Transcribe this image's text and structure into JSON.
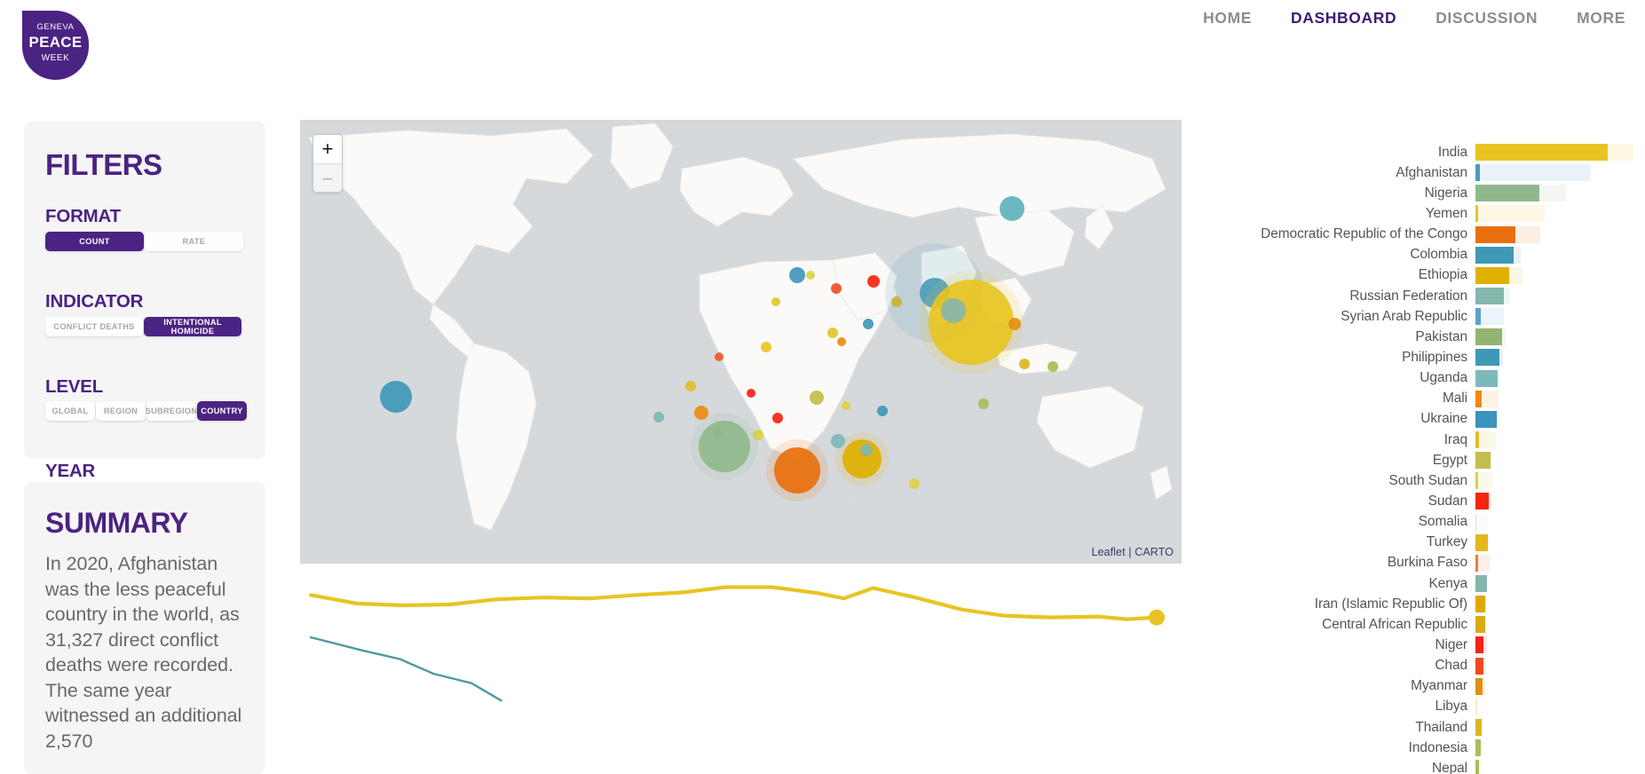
{
  "header": {
    "logo": {
      "line1": "GENEVA",
      "line2": "PEACE",
      "line3": "WEEK",
      "color": "#4b2382"
    },
    "nav": [
      {
        "label": "HOME",
        "active": false
      },
      {
        "label": "DASHBOARD",
        "active": true
      },
      {
        "label": "DISCUSSION",
        "active": false
      },
      {
        "label": "MORE",
        "active": false
      }
    ]
  },
  "filters": {
    "title": "FILTERS",
    "groups": [
      {
        "label": "FORMAT",
        "options": [
          {
            "label": "COUNT",
            "selected": true
          },
          {
            "label": "RATE",
            "selected": false
          }
        ]
      },
      {
        "label": "INDICATOR",
        "options": [
          {
            "label": "CONFLICT DEATHS",
            "selected": false
          },
          {
            "label": "INTENTIONAL HOMICIDE",
            "selected": true
          }
        ]
      },
      {
        "label": "LEVEL",
        "options": [
          {
            "label": "GLOBAL",
            "selected": false
          },
          {
            "label": "REGION",
            "selected": false
          },
          {
            "label": "SUBREGION",
            "selected": false
          },
          {
            "label": "COUNTRY",
            "selected": true
          }
        ]
      }
    ],
    "year": {
      "label": "YEAR",
      "value": "2020",
      "min": 1990,
      "max": 2020,
      "position_pct": 100
    }
  },
  "summary": {
    "title": "SUMMARY",
    "text": "In 2020, Afghanistan was the less peaceful country in the world, as 31,327 direct conflict deaths were recorded. The same year witnessed an additional 2,570"
  },
  "map": {
    "zoom_in_label": "+",
    "zoom_out_label": "−",
    "attribution_leaflet": "Leaflet",
    "attribution_sep": " | ",
    "attribution_carto": "CARTO",
    "ocean_color": "#d5d9db",
    "land_color": "#fbfaf8"
  },
  "chart_data": [
    {
      "type": "bar",
      "title": "",
      "orientation": "horizontal",
      "xlabel": "",
      "ylabel": "",
      "note": "Two stacked measures per country: foreground = intentional homicide count, background (lighter tint) = total. Values are pixel-proportional estimates of bar length (0-1 of chart width).",
      "categories": [
        "India",
        "Afghanistan",
        "Nigeria",
        "Yemen",
        "Democratic Republic of the Congo",
        "Colombia",
        "Ethiopia",
        "Russian Federation",
        "Syrian Arab Republic",
        "Pakistan",
        "Philippines",
        "Uganda",
        "Mali",
        "Ukraine",
        "Iraq",
        "Egypt",
        "South Sudan",
        "Sudan",
        "Somalia",
        "Turkey",
        "Burkina Faso",
        "Kenya",
        "Iran (Islamic Republic Of)",
        "Central African Republic",
        "Niger",
        "Chad",
        "Myanmar",
        "Libya",
        "Thailand",
        "Indonesia",
        "Nepal"
      ],
      "series": [
        {
          "name": "foreground",
          "values": [
            0.805,
            0.029,
            0.39,
            0.014,
            0.245,
            0.235,
            0.205,
            0.175,
            0.032,
            0.16,
            0.145,
            0.135,
            0.04,
            0.13,
            0.022,
            0.09,
            0.018,
            0.08,
            0.006,
            0.075,
            0.017,
            0.07,
            0.062,
            0.06,
            0.05,
            0.046,
            0.044,
            0.01,
            0.038,
            0.03,
            0.024
          ]
        },
        {
          "name": "background",
          "values": [
            0.96,
            0.7,
            0.55,
            0.42,
            0.395,
            0.275,
            0.285,
            0.205,
            0.175,
            0.185,
            0.165,
            0.145,
            0.14,
            0.135,
            0.125,
            0.1,
            0.105,
            0.09,
            0.08,
            0.078,
            0.085,
            0.072,
            0.064,
            0.062,
            0.07,
            0.065,
            0.058,
            0.05,
            0.04,
            0.032,
            0.026
          ]
        }
      ],
      "colors": [
        "#e8c422",
        "#4a9cba",
        "#8fb98c",
        "#e2c72a",
        "#e96f0d",
        "#3f98b8",
        "#e0b000",
        "#86b6ad",
        "#5aa4c1",
        "#93b572",
        "#3f98b8",
        "#7cb9bb",
        "#ee8a12",
        "#3a94bd",
        "#ddbf2d",
        "#c3bd4a",
        "#ded04a",
        "#f4260f",
        "#cfe0e4",
        "#e2b81a",
        "#ef7a43",
        "#86b6ad",
        "#e0a800",
        "#d9ab12",
        "#f42314",
        "#ed4b1a",
        "#e08f13",
        "#f2efcf",
        "#dcb620",
        "#a9bd5e",
        "#a5be52"
      ]
    },
    {
      "type": "line",
      "title": "",
      "xlabel": "",
      "ylabel": "",
      "note": "Time series trend lines under the map; gold line carries an end-point marker.",
      "series": [
        {
          "name": "line-gold",
          "color": "#e8c422",
          "marker_end": true,
          "points_pct": [
            [
              0.0,
              0.28
            ],
            [
              0.055,
              0.38
            ],
            [
              0.11,
              0.4
            ],
            [
              0.165,
              0.39
            ],
            [
              0.22,
              0.33
            ],
            [
              0.275,
              0.31
            ],
            [
              0.33,
              0.32
            ],
            [
              0.385,
              0.28
            ],
            [
              0.44,
              0.25
            ],
            [
              0.49,
              0.19
            ],
            [
              0.545,
              0.19
            ],
            [
              0.6,
              0.26
            ],
            [
              0.63,
              0.32
            ],
            [
              0.665,
              0.2
            ],
            [
              0.715,
              0.31
            ],
            [
              0.77,
              0.45
            ],
            [
              0.82,
              0.52
            ],
            [
              0.875,
              0.54
            ],
            [
              0.93,
              0.53
            ],
            [
              0.965,
              0.56
            ],
            [
              1.0,
              0.54
            ]
          ]
        },
        {
          "name": "line-teal",
          "color": "#4e9a9c",
          "marker_end": false,
          "points_pct": [
            [
              0.0,
              0.77
            ],
            [
              0.06,
              0.92
            ],
            [
              0.105,
              1.02
            ],
            [
              0.145,
              1.19
            ],
            [
              0.19,
              1.3
            ],
            [
              0.225,
              1.5
            ]
          ]
        }
      ]
    }
  ]
}
